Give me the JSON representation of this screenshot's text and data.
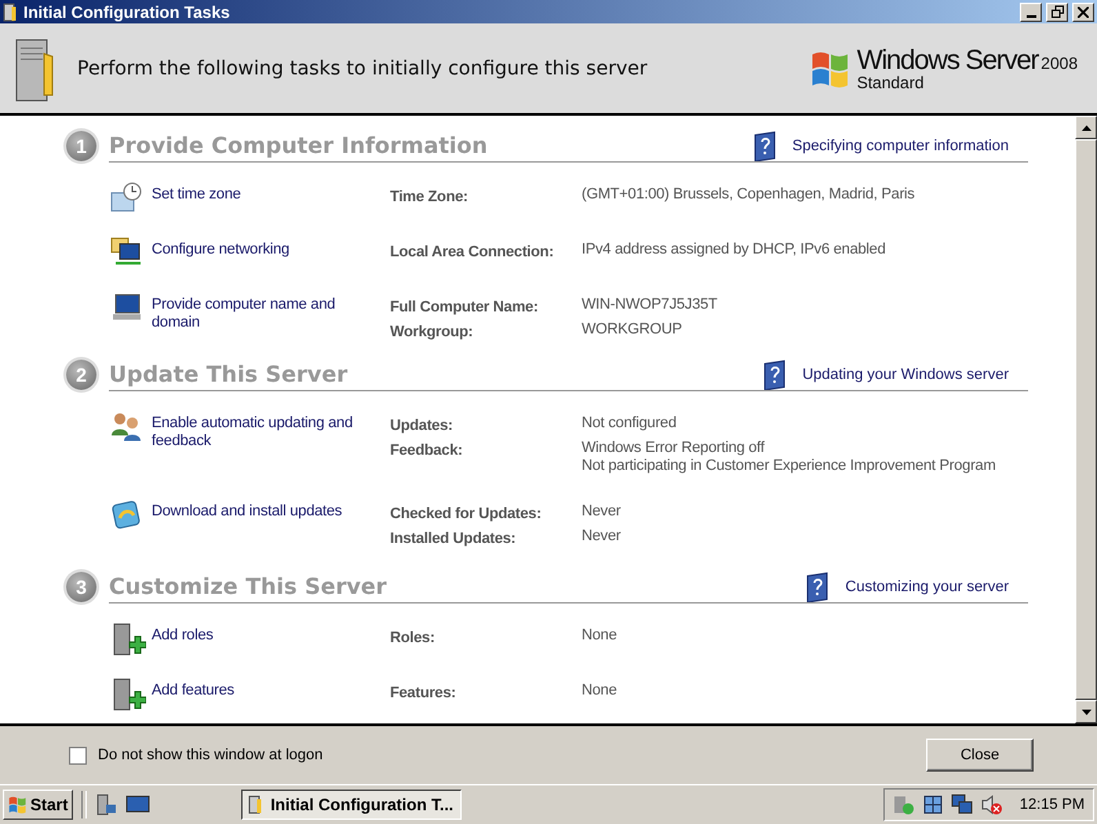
{
  "window": {
    "title": "Initial Configuration Tasks"
  },
  "header": {
    "text": "Perform the following tasks to initially configure this server",
    "logo_name": "Windows Server",
    "logo_version": "2008",
    "logo_edition": "Standard"
  },
  "sections": [
    {
      "number": "1",
      "title": "Provide Computer Information",
      "help_link": "Specifying computer information",
      "tasks": [
        {
          "kind": "clock",
          "label": "Set time zone",
          "details": [
            {
              "label": "Time Zone:",
              "values": [
                "(GMT+01:00) Brussels, Copenhagen, Madrid, Paris"
              ]
            }
          ]
        },
        {
          "kind": "network",
          "label": "Configure networking",
          "details": [
            {
              "label": "Local Area Connection:",
              "values": [
                "IPv4 address assigned by DHCP, IPv6 enabled"
              ]
            }
          ]
        },
        {
          "kind": "computer",
          "label": "Provide computer name and domain",
          "details": [
            {
              "label": "Full Computer Name:",
              "values": [
                "WIN-NWOP7J5J35T"
              ]
            },
            {
              "label": "Workgroup:",
              "values": [
                "WORKGROUP"
              ]
            }
          ]
        }
      ]
    },
    {
      "number": "2",
      "title": "Update This Server",
      "help_link": "Updating your Windows server",
      "tasks": [
        {
          "kind": "users",
          "label": "Enable automatic updating and feedback",
          "details": [
            {
              "label": "Updates:",
              "values": [
                "Not configured"
              ]
            },
            {
              "label": "Feedback:",
              "values": [
                "Windows Error Reporting off",
                "Not participating in Customer Experience Improvement Program"
              ]
            }
          ]
        },
        {
          "kind": "update",
          "label": "Download and install updates",
          "details": [
            {
              "label": "Checked for Updates:",
              "values": [
                "Never"
              ]
            },
            {
              "label": "Installed Updates:",
              "values": [
                "Never"
              ]
            }
          ]
        }
      ]
    },
    {
      "number": "3",
      "title": "Customize This Server",
      "help_link": "Customizing your server",
      "tasks": [
        {
          "kind": "server-add",
          "label": "Add roles",
          "details": [
            {
              "label": "Roles:",
              "values": [
                "None"
              ]
            }
          ]
        },
        {
          "kind": "server-add",
          "label": "Add features",
          "details": [
            {
              "label": "Features:",
              "values": [
                "None"
              ]
            }
          ]
        }
      ]
    }
  ],
  "footer": {
    "checkbox": {
      "label": "Do not show this window at logon",
      "checked": false
    },
    "button": "Close"
  },
  "taskbar": {
    "start": "Start",
    "task": "Initial Configuration T...",
    "clock": "12:15 PM"
  }
}
